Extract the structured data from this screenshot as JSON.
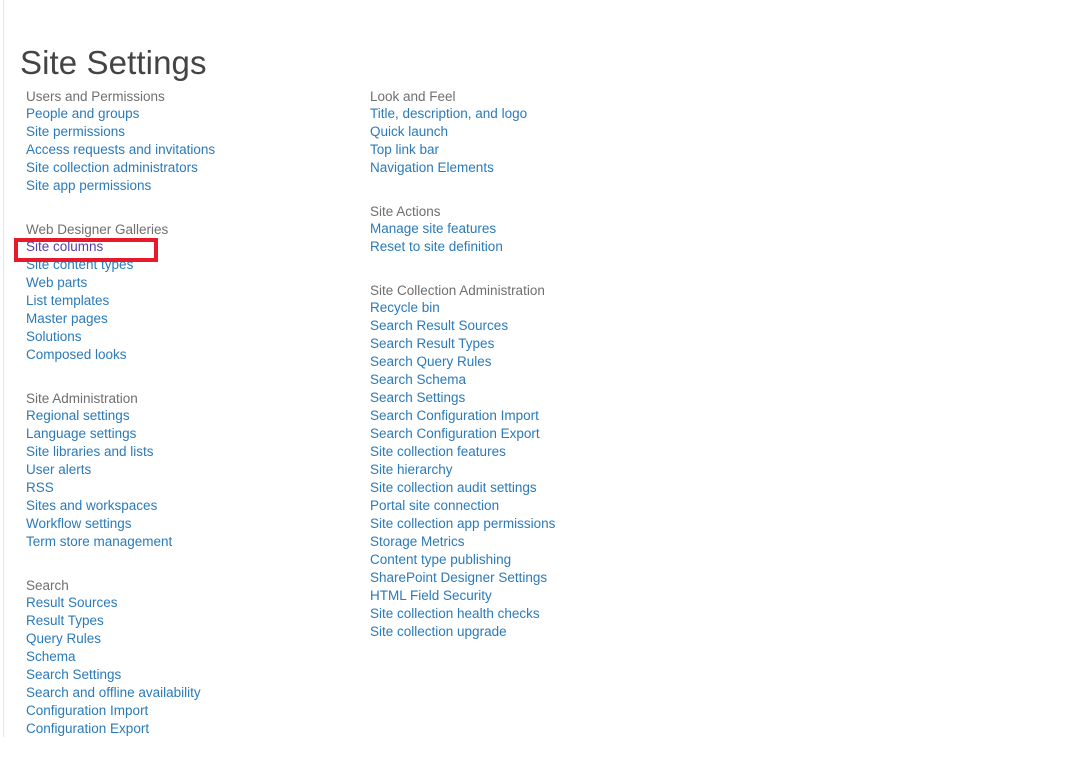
{
  "page": {
    "title": "Site Settings",
    "title_color": "#444444",
    "heading_color": "#6f6f6f",
    "link_color": "#2a7ab9",
    "visited_link_color": "#5b3f9e",
    "background_color": "#ffffff"
  },
  "annotation": {
    "name": "site-columns-highlight",
    "color": "#e8192a",
    "target_label": "Site columns"
  },
  "left_column": [
    {
      "heading": "Users and Permissions",
      "links": [
        {
          "label": "People and groups",
          "visited": false
        },
        {
          "label": "Site permissions",
          "visited": false
        },
        {
          "label": "Access requests and invitations",
          "visited": false
        },
        {
          "label": "Site collection administrators",
          "visited": false
        },
        {
          "label": "Site app permissions",
          "visited": false
        }
      ]
    },
    {
      "heading": "Web Designer Galleries",
      "links": [
        {
          "label": "Site columns",
          "visited": true
        },
        {
          "label": "Site content types",
          "visited": false
        },
        {
          "label": "Web parts",
          "visited": false
        },
        {
          "label": "List templates",
          "visited": false
        },
        {
          "label": "Master pages",
          "visited": false
        },
        {
          "label": "Solutions",
          "visited": false
        },
        {
          "label": "Composed looks",
          "visited": false
        }
      ]
    },
    {
      "heading": "Site Administration",
      "links": [
        {
          "label": "Regional settings",
          "visited": false
        },
        {
          "label": "Language settings",
          "visited": false
        },
        {
          "label": "Site libraries and lists",
          "visited": false
        },
        {
          "label": "User alerts",
          "visited": false
        },
        {
          "label": "RSS",
          "visited": false
        },
        {
          "label": "Sites and workspaces",
          "visited": false
        },
        {
          "label": "Workflow settings",
          "visited": false
        },
        {
          "label": "Term store management",
          "visited": false
        }
      ]
    },
    {
      "heading": "Search",
      "links": [
        {
          "label": "Result Sources",
          "visited": false
        },
        {
          "label": "Result Types",
          "visited": false
        },
        {
          "label": "Query Rules",
          "visited": false
        },
        {
          "label": "Schema",
          "visited": false
        },
        {
          "label": "Search Settings",
          "visited": false
        },
        {
          "label": "Search and offline availability",
          "visited": false
        },
        {
          "label": "Configuration Import",
          "visited": false
        },
        {
          "label": "Configuration Export",
          "visited": false
        }
      ]
    }
  ],
  "right_column": [
    {
      "heading": "Look and Feel",
      "links": [
        {
          "label": "Title, description, and logo",
          "visited": false
        },
        {
          "label": "Quick launch",
          "visited": false
        },
        {
          "label": "Top link bar",
          "visited": false
        },
        {
          "label": "Navigation Elements",
          "visited": false
        }
      ]
    },
    {
      "heading": "Site Actions",
      "links": [
        {
          "label": "Manage site features",
          "visited": false
        },
        {
          "label": "Reset to site definition",
          "visited": false
        }
      ]
    },
    {
      "heading": "Site Collection Administration",
      "links": [
        {
          "label": "Recycle bin",
          "visited": false
        },
        {
          "label": "Search Result Sources",
          "visited": false
        },
        {
          "label": "Search Result Types",
          "visited": false
        },
        {
          "label": "Search Query Rules",
          "visited": false
        },
        {
          "label": "Search Schema",
          "visited": false
        },
        {
          "label": "Search Settings",
          "visited": false
        },
        {
          "label": "Search Configuration Import",
          "visited": false
        },
        {
          "label": "Search Configuration Export",
          "visited": false
        },
        {
          "label": "Site collection features",
          "visited": false
        },
        {
          "label": "Site hierarchy",
          "visited": false
        },
        {
          "label": "Site collection audit settings",
          "visited": false
        },
        {
          "label": "Portal site connection",
          "visited": false
        },
        {
          "label": "Site collection app permissions",
          "visited": false
        },
        {
          "label": "Storage Metrics",
          "visited": false
        },
        {
          "label": "Content type publishing",
          "visited": false
        },
        {
          "label": "SharePoint Designer Settings",
          "visited": false
        },
        {
          "label": "HTML Field Security",
          "visited": false
        },
        {
          "label": "Site collection health checks",
          "visited": false
        },
        {
          "label": "Site collection upgrade",
          "visited": false
        }
      ]
    }
  ]
}
